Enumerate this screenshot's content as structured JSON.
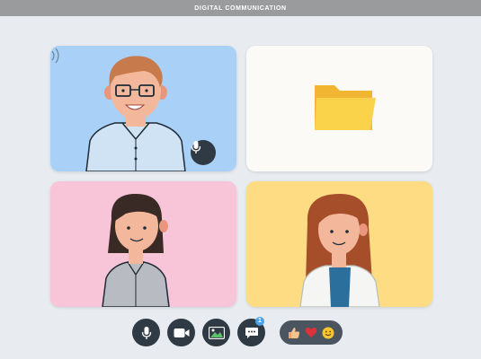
{
  "window": {
    "title": "DIGITAL COMMUNICATION"
  },
  "colors": {
    "background": "#e8ecf0",
    "titlebar": "#9a9b9d",
    "tile_blue": "#a9d1f7",
    "tile_white": "#fbfaf6",
    "tile_pink": "#f7c4d8",
    "tile_yellow": "#fddc83",
    "control_dark": "#2f3a44",
    "notification_blue": "#4aa3e8"
  },
  "participants": [
    {
      "tile": "man-with-glasses",
      "speaking": true,
      "icon": "microphone-icon"
    },
    {
      "tile": "shared-folder",
      "icon": "folder-icon"
    },
    {
      "tile": "woman-short-hair"
    },
    {
      "tile": "woman-long-hair"
    }
  ],
  "controls": [
    {
      "name": "microphone-button",
      "icon": "microphone-icon"
    },
    {
      "name": "camera-button",
      "icon": "video-camera-icon"
    },
    {
      "name": "screen-share-button",
      "icon": "image-icon"
    },
    {
      "name": "chat-button",
      "icon": "chat-icon",
      "badge": "1"
    }
  ],
  "reactions": [
    "thumbs-up-icon",
    "heart-icon",
    "smile-icon"
  ]
}
